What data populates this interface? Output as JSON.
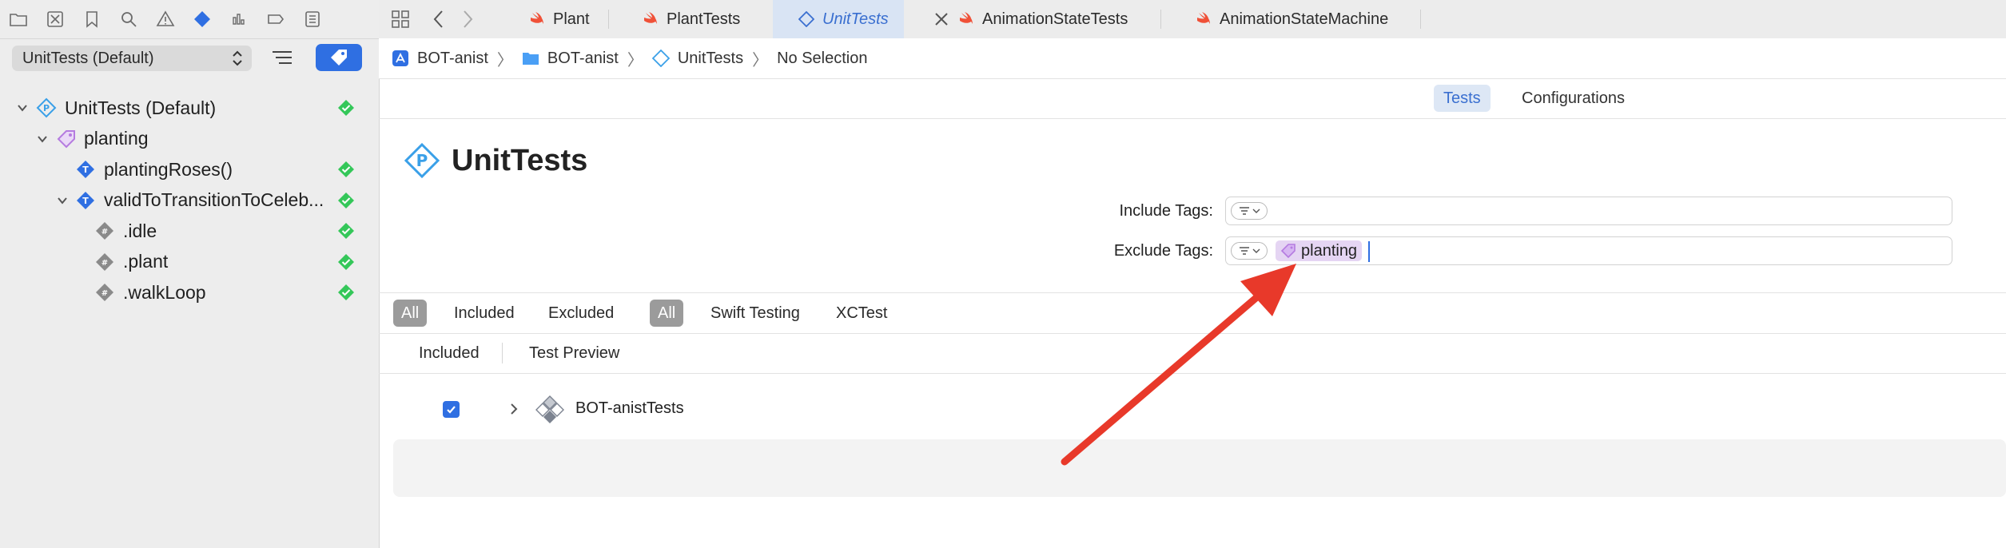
{
  "navigator": {
    "toolbar_icons": [
      "folder-icon",
      "source-control-icon",
      "bookmark-icon",
      "find-icon",
      "issue-icon",
      "test-icon",
      "debug-icon",
      "breakpoint-icon",
      "report-icon"
    ],
    "scheme_select": "UnitTests (Default)",
    "tree": [
      {
        "label": "UnitTests (Default)",
        "icon": "test-plan-icon",
        "expanded": true,
        "passed": true
      },
      {
        "label": "planting",
        "icon": "tag-icon",
        "expanded": true,
        "passed": false
      },
      {
        "label": "plantingRoses()",
        "icon": "test-icon",
        "passed": true
      },
      {
        "label": "validToTransitionToCeleb...",
        "icon": "test-icon",
        "expanded": true,
        "passed": true
      },
      {
        "label": ".idle",
        "icon": "argument-icon",
        "passed": true
      },
      {
        "label": ".plant",
        "icon": "argument-icon",
        "passed": true
      },
      {
        "label": ".walkLoop",
        "icon": "argument-icon",
        "passed": true
      }
    ]
  },
  "tabs": [
    {
      "label": "Plant",
      "icon": "swift-icon"
    },
    {
      "label": "PlantTests",
      "icon": "swift-icon"
    },
    {
      "label": "UnitTests",
      "icon": "test-plan-icon",
      "active": true
    },
    {
      "label": "AnimationStateTests",
      "icon": "swift-icon"
    },
    {
      "label": "AnimationStateMachine",
      "icon": "swift-icon"
    }
  ],
  "breadcrumb": [
    "BOT-anist",
    "BOT-anist",
    "UnitTests",
    "No Selection"
  ],
  "segments": {
    "tests": "Tests",
    "configurations": "Configurations"
  },
  "editor": {
    "title": "UnitTests",
    "include_label": "Include Tags:",
    "exclude_label": "Exclude Tags:",
    "exclude_token": "planting"
  },
  "filters": {
    "group1": [
      "All",
      "Included",
      "Excluded"
    ],
    "group2": [
      "All",
      "Swift Testing",
      "XCTest"
    ]
  },
  "subtabs": [
    "Included",
    "Test Preview"
  ],
  "test_row": {
    "label": "BOT-anistTests",
    "checked": true
  },
  "colors": {
    "accent": "#2f6fe2",
    "pass": "#34c759",
    "arrow": "#e8392a",
    "tag": "#b57be0"
  }
}
